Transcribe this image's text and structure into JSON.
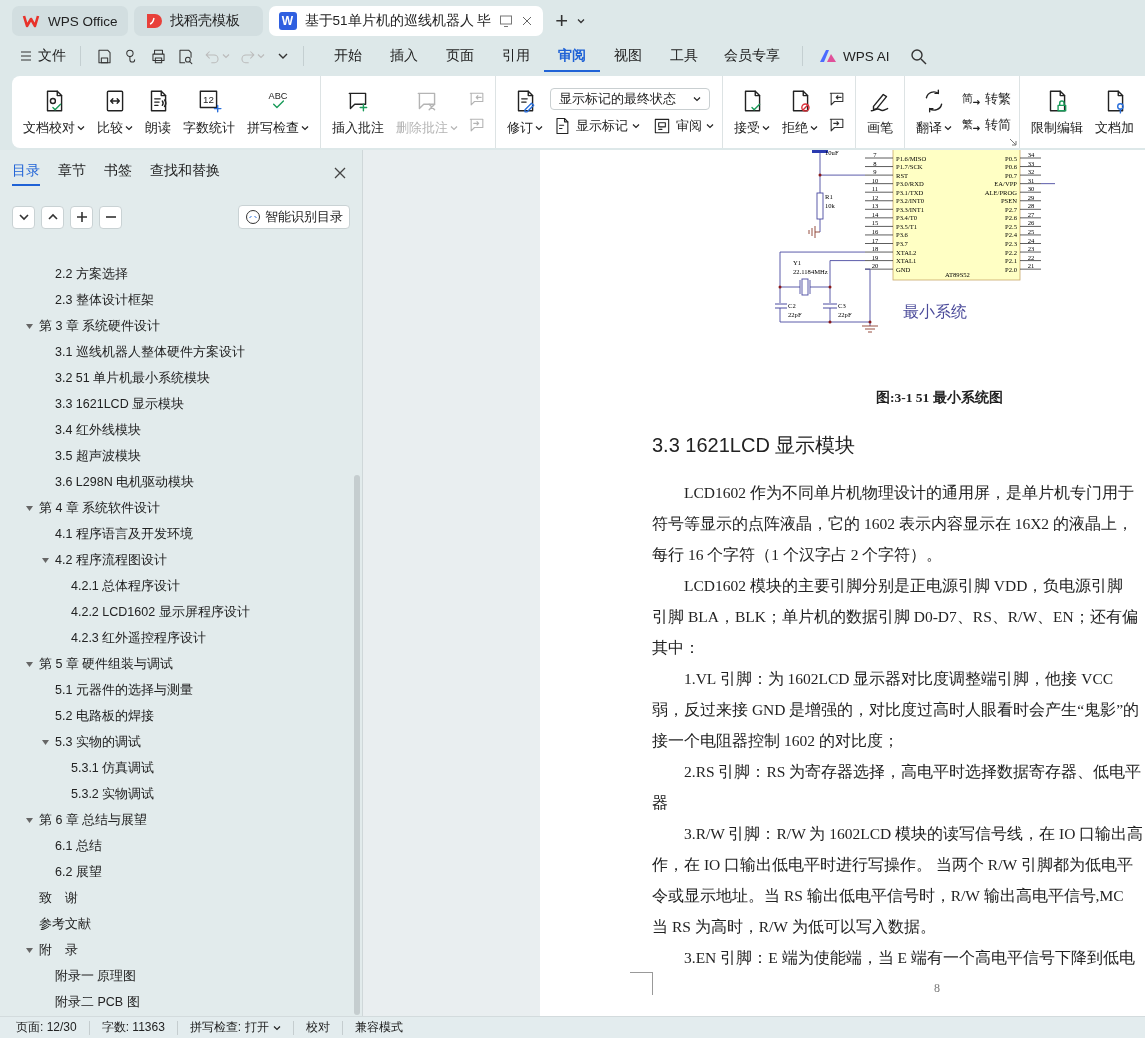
{
  "title_tabs": [
    {
      "kind": "wps",
      "label": "WPS Office",
      "selected": false
    },
    {
      "kind": "template",
      "label": "找稻壳模板",
      "selected": false
    },
    {
      "kind": "doc",
      "glyph": "W",
      "label": "基于51单片机的巡线机器人 毕",
      "selected": true
    }
  ],
  "new_tab": "+",
  "menu": {
    "file": "文件",
    "quick_access": [
      {
        "disabled": false
      },
      {
        "disabled": false
      },
      {
        "disabled": false
      },
      {
        "disabled": false
      },
      {
        "disabled": true
      },
      {
        "disabled": true
      }
    ],
    "tabs": [
      {
        "label": "开始",
        "selected": false
      },
      {
        "label": "插入",
        "selected": false
      },
      {
        "label": "页面",
        "selected": false
      },
      {
        "label": "引用",
        "selected": false
      },
      {
        "label": "审阅",
        "selected": true
      },
      {
        "label": "视图",
        "selected": false
      },
      {
        "label": "工具",
        "selected": false
      },
      {
        "label": "会员专享",
        "selected": false
      }
    ],
    "ai": "WPS AI"
  },
  "ribbon": {
    "groups": [
      {
        "items": [
          {
            "kind": "big",
            "label": "文档校对",
            "dropdown": true,
            "disabled": false
          },
          {
            "kind": "big",
            "label": "比较",
            "dropdown": true,
            "disabled": false
          },
          {
            "kind": "big",
            "label": "朗读",
            "dropdown": false,
            "disabled": false
          },
          {
            "kind": "big",
            "glyph": "12",
            "label": "字数统计",
            "dropdown": false,
            "disabled": false
          },
          {
            "kind": "big",
            "glyph": "ABC",
            "label": "拼写检查",
            "dropdown": true,
            "disabled": false
          }
        ]
      },
      {
        "items": [
          {
            "kind": "big",
            "label": "插入批注",
            "dropdown": false,
            "disabled": false
          },
          {
            "kind": "big",
            "label": "删除批注",
            "dropdown": true,
            "disabled": true
          },
          {
            "kind": "stack",
            "items": [
              {
                "kind": "icon",
                "disabled": true
              },
              {
                "kind": "icon",
                "disabled": true
              }
            ]
          }
        ]
      },
      {
        "items": [
          {
            "kind": "big",
            "label": "修订",
            "dropdown": true,
            "disabled": false
          },
          {
            "kind": "stack",
            "items": [
              {
                "kind": "select",
                "value": "显示标记的最终状态"
              },
              {
                "kind": "row",
                "items": [
                  {
                    "kind": "small",
                    "label": "显示标记",
                    "dropdown": true
                  },
                  {
                    "kind": "small",
                    "label": "审阅",
                    "dropdown": true
                  }
                ]
              }
            ]
          }
        ]
      },
      {
        "items": [
          {
            "kind": "big",
            "label": "接受",
            "dropdown": true,
            "disabled": false
          },
          {
            "kind": "big",
            "label": "拒绝",
            "dropdown": true,
            "disabled": false
          },
          {
            "kind": "stack",
            "items": [
              {
                "kind": "icon",
                "disabled": false
              },
              {
                "kind": "icon",
                "disabled": false
              }
            ]
          }
        ]
      },
      {
        "items": [
          {
            "kind": "big",
            "label": "画笔",
            "dropdown": false,
            "disabled": false
          }
        ]
      },
      {
        "launcher": true,
        "items": [
          {
            "kind": "big",
            "label": "翻译",
            "dropdown": true,
            "disabled": false
          },
          {
            "kind": "stack",
            "items": [
              {
                "kind": "small",
                "glyph": "简",
                "label": "转繁",
                "dropdown": false
              },
              {
                "kind": "small",
                "glyph": "繁",
                "label": "转简",
                "dropdown": false
              }
            ]
          }
        ]
      },
      {
        "items": [
          {
            "kind": "big",
            "label": "限制编辑",
            "dropdown": false,
            "disabled": false
          },
          {
            "kind": "big",
            "label": "文档加",
            "dropdown": false,
            "disabled": false
          }
        ]
      }
    ]
  },
  "sidebar": {
    "tabs": [
      {
        "label": "目录",
        "selected": true
      },
      {
        "label": "章节",
        "selected": false
      },
      {
        "label": "书签",
        "selected": false
      },
      {
        "label": "查找和替换",
        "selected": false
      }
    ],
    "smart_button": "智能识别目录",
    "toc": [
      {
        "children": [
          {
            "label": "2.2 方案选择"
          },
          {
            "label": "2.3 整体设计框架"
          }
        ]
      },
      {
        "label": "第 3 章 系统硬件设计",
        "expanded": true,
        "children": [
          {
            "label": "3.1 巡线机器人整体硬件方案设计"
          },
          {
            "label": "3.2 51 单片机最小系统模块"
          },
          {
            "label": "3.3 1621LCD 显示模块"
          },
          {
            "label": "3.4 红外线模块"
          },
          {
            "label": "3.5 超声波模块"
          },
          {
            "label": "3.6 L298N 电机驱动模块"
          }
        ]
      },
      {
        "label": "第 4 章 系统软件设计",
        "expanded": true,
        "children": [
          {
            "label": "4.1 程序语言及开发环境"
          },
          {
            "label": "4.2 程序流程图设计",
            "expanded": true,
            "children": [
              {
                "label": "4.2.1 总体程序设计"
              },
              {
                "label": "4.2.2 LCD1602 显示屏程序设计"
              },
              {
                "label": "4.2.3 红外遥控程序设计"
              }
            ]
          }
        ]
      },
      {
        "label": "第 5 章 硬件组装与调试",
        "expanded": true,
        "children": [
          {
            "label": "5.1 元器件的选择与测量"
          },
          {
            "label": "5.2 电路板的焊接"
          },
          {
            "label": "5.3 实物的调试",
            "expanded": true,
            "children": [
              {
                "label": "5.3.1 仿真调试"
              },
              {
                "label": "5.3.2 实物调试"
              }
            ]
          }
        ]
      },
      {
        "label": "第 6 章 总结与展望",
        "expanded": true,
        "children": [
          {
            "label": "6.1 总结"
          },
          {
            "label": "6.2 展望"
          }
        ]
      },
      {
        "label": "致　谢"
      },
      {
        "label": "参考文献"
      },
      {
        "label": "附　录",
        "expanded": true,
        "children": [
          {
            "label": "附录一 原理图"
          },
          {
            "label": "附录二 PCB 图"
          }
        ]
      }
    ]
  },
  "document": {
    "schematic": {
      "chip": "AT89S52",
      "title": "最小系统",
      "left_pins": [
        {
          "number": "7",
          "name": "P1.6/MISO"
        },
        {
          "number": "8",
          "name": "P1.7/SCK"
        },
        {
          "number": "9",
          "name": "RST"
        },
        {
          "number": "10",
          "name": "P3.0/RXD"
        },
        {
          "number": "11",
          "name": "P3.1/TXD"
        },
        {
          "number": "12",
          "name": "P3.2/INT0"
        },
        {
          "number": "13",
          "name": "P3.3/INT1"
        },
        {
          "number": "14",
          "name": "P3.4/T0"
        },
        {
          "number": "15",
          "name": "P3.5/T1"
        },
        {
          "number": "16",
          "name": "P3.6"
        },
        {
          "number": "17",
          "name": "P3.7"
        },
        {
          "number": "18",
          "name": "XTAL2"
        },
        {
          "number": "19",
          "name": "XTAL1"
        },
        {
          "number": "20",
          "name": "GND"
        }
      ],
      "right_pins": [
        {
          "number": "34",
          "name": "P0.5"
        },
        {
          "number": "33",
          "name": "P0.6"
        },
        {
          "number": "32",
          "name": "P0.7"
        },
        {
          "number": "31",
          "name": "EA/VPP"
        },
        {
          "number": "30",
          "name": "ALE/PROG"
        },
        {
          "number": "29",
          "name": "PSEN"
        },
        {
          "number": "28",
          "name": "P2.7"
        },
        {
          "number": "27",
          "name": "P2.6"
        },
        {
          "number": "26",
          "name": "P2.5"
        },
        {
          "number": "25",
          "name": "P2.4"
        },
        {
          "number": "24",
          "name": "P2.3"
        },
        {
          "number": "23",
          "name": "P2.2"
        },
        {
          "number": "22",
          "name": "P2.1"
        },
        {
          "number": "21",
          "name": "P2.0"
        }
      ],
      "capacitor": "10uF",
      "resistor": "R1",
      "resistor_value": "10k",
      "crystal": "Y1",
      "crystal_value": "22.1184MHz",
      "caps": [
        {
          "name": "C2",
          "value": "22pF"
        },
        {
          "name": "C3",
          "value": "22pF"
        }
      ]
    },
    "caption": "图:3-1 51 最小系统图",
    "heading": "3.3 1621LCD 显示模块",
    "paragraphs": [
      {
        "lines": [
          "LCD1602 作为不同单片机物理设计的通用屏，是单片机专门用于",
          "符号等显示的点阵液晶，它的 1602 表示内容显示在 16X2 的液晶上，",
          "每行 16 个字符（1 个汉字占 2 个字符）。"
        ]
      },
      {
        "lines": [
          "LCD1602 模块的主要引脚分别是正电源引脚 VDD，负电源引脚",
          "引脚 BLA，BLK；单片机的数据引脚 D0-D7、RS、R/W、EN；还有偏",
          "其中："
        ]
      },
      {
        "lines": [
          "1.VL 引脚：为 1602LCD 显示器对比度调整端引脚，他接 VCC",
          "弱，反过来接 GND 是增强的，对比度过高时人眼看时会产生“鬼影”的",
          "接一个电阻器控制 1602 的对比度；"
        ]
      },
      {
        "lines": [
          "2.RS 引脚：RS 为寄存器选择，高电平时选择数据寄存器、低电平",
          "器"
        ]
      },
      {
        "lines": [
          "3.R/W 引脚：R/W 为 1602LCD 模块的读写信号线，在 IO 口输出高",
          "作，在 IO 口输出低电平时进行写操作。 当两个 R/W 引脚都为低电平",
          "令或显示地址。当 RS 输出低电平信号时，R/W 输出高电平信号,MC",
          "当 RS 为高时，R/W 为低可以写入数据。"
        ]
      },
      {
        "lines": [
          "3.EN 引脚：E 端为使能端，当 E 端有一个高电平信号下降到低电"
        ]
      }
    ],
    "page_number": "8"
  },
  "status_bar": [
    {
      "kind": "text",
      "label": "页面: 12/30"
    },
    {
      "kind": "text",
      "label": "字数: 11363"
    },
    {
      "kind": "dropdown",
      "label": "拼写检查: 打开"
    },
    {
      "kind": "button",
      "label": "校对"
    },
    {
      "kind": "text",
      "label": "兼容模式"
    }
  ]
}
